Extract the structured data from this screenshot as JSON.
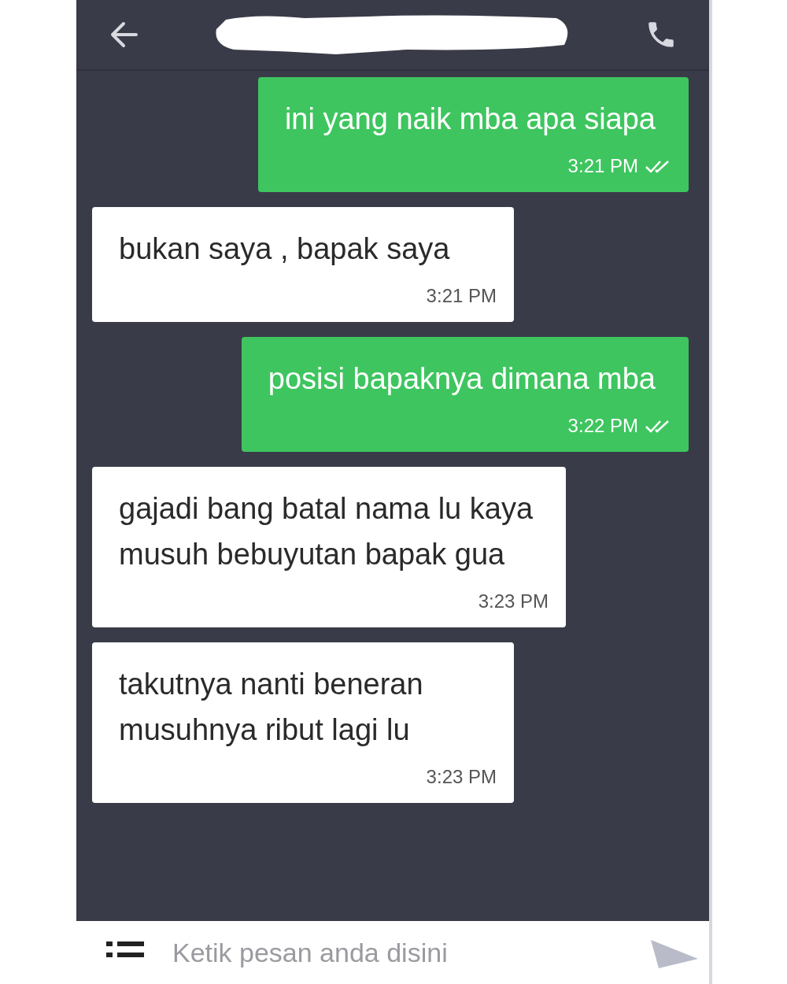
{
  "messages": [
    {
      "kind": "sent",
      "text": "ini yang naik mba apa siapa",
      "time": "3:21 PM",
      "read": true
    },
    {
      "kind": "received",
      "text": "bukan saya , bapak saya",
      "time": "3:21 PM"
    },
    {
      "kind": "sent",
      "text": "posisi bapaknya dimana mba",
      "time": "3:22 PM",
      "read": true
    },
    {
      "kind": "received",
      "text": "gajadi bang batal nama lu kaya\nmusuh bebuyutan bapak gua",
      "time": "3:23 PM"
    },
    {
      "kind": "received",
      "text": "takutnya nanti beneran\nmusuhnya ribut lagi lu",
      "time": "3:23 PM"
    }
  ],
  "composer": {
    "placeholder": "Ketik pesan anda disini"
  }
}
